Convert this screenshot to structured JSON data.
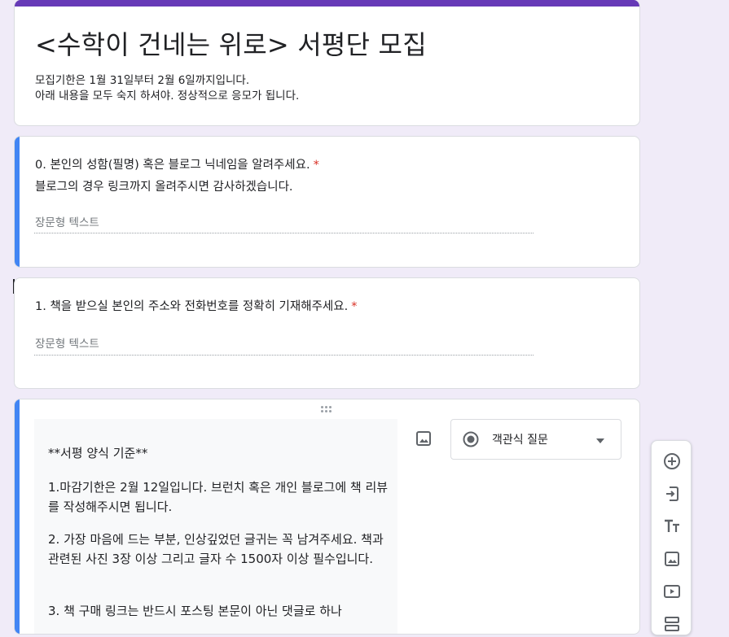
{
  "form": {
    "title": "<수학이 건네는 위로> 서평단 모집",
    "description": [
      "모집기한은 1월 31일부터 2월 6일까지입니다.",
      "아래 내용을 모두 숙지 하셔야. 정상적으로 응모가 됩니다."
    ],
    "accent_color": "#673ab7",
    "focus_color": "#4285f4"
  },
  "questions": [
    {
      "title": "0. 본인의 성함(필명) 혹은 블로그 닉네임을 알려주세요.",
      "required_mark": "*",
      "subtitle": "블로그의 경우 링크까지 올려주시면 감사하겠습니다.",
      "placeholder": "장문형 텍스트"
    },
    {
      "title": "1. 책을 받으실 본인의 주소와 전화번호를 정확히 기재해주세요.",
      "required_mark": "*",
      "placeholder": "장문형 텍스트"
    }
  ],
  "editing_question": {
    "lines": [
      "**서평 양식 기준**",
      "1.마감기한은 2월 12일입니다. 브런치 혹은 개인 블로그에 책 리뷰를 작성해주시면 됩니다.",
      "2. 가장 마음에 드는 부분, 인상깊었던 글귀는 꼭 남겨주세요. 책과 관련된 사진 3장 이상 그리고 글자 수 1500자 이상 필수입니다.",
      "3. 책 구매 링크는 반드시 포스팅 본문이 아닌 댓글로 하나"
    ],
    "type_label": "객관식 질문"
  },
  "toolbar": {
    "icons": [
      "add-question-icon",
      "import-questions-icon",
      "add-title-icon",
      "add-image-icon",
      "add-video-icon",
      "add-section-icon"
    ]
  }
}
